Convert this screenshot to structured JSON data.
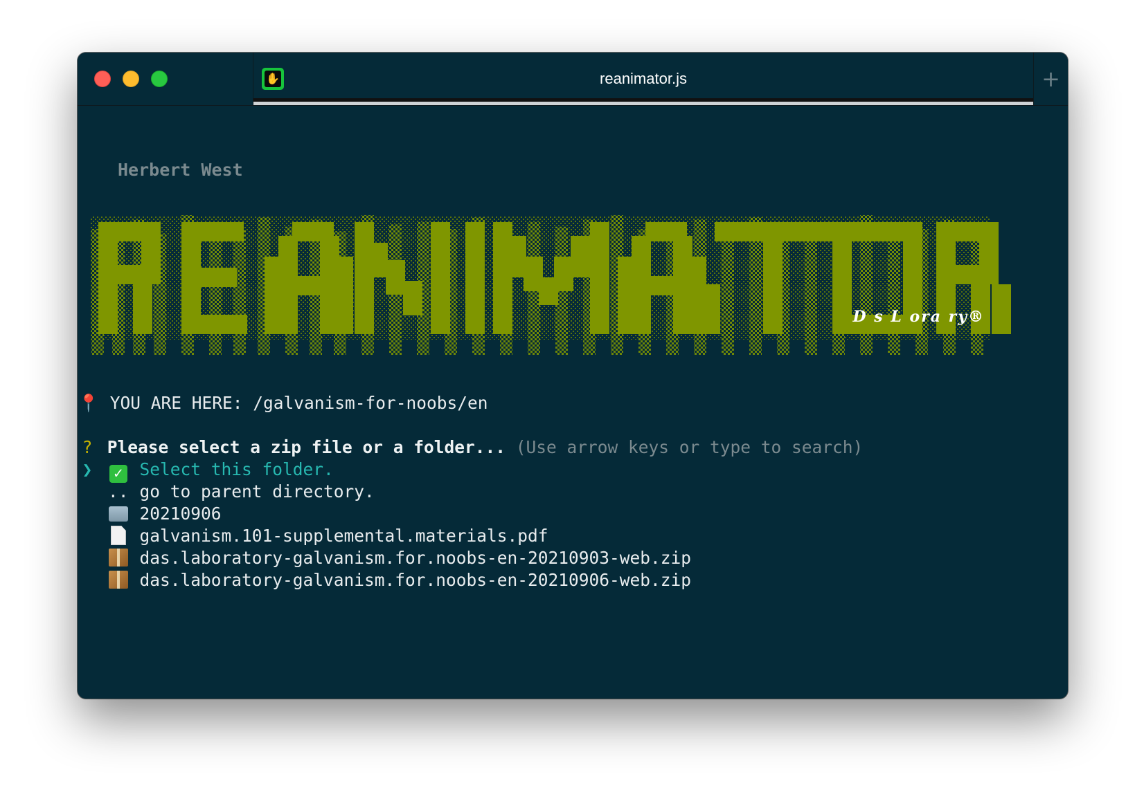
{
  "window": {
    "tab_title": "reanimator.js",
    "new_tab_label": "+",
    "tab_icon": "hand-icon"
  },
  "banner": {
    "subtitle": "Herbert West",
    "logo_text": "REANIMATOR",
    "lab_label": "D s L ora ry®",
    "logo_color": "#7f9600"
  },
  "location": {
    "icon": "pushpin-icon",
    "text": "YOU ARE HERE: /galvanism-for-noobs/en"
  },
  "prompt": {
    "marker": "?",
    "question": "Please select a zip file or a folder...",
    "hint": "(Use arrow keys or type to search)",
    "cursor": "❯"
  },
  "choices": [
    {
      "icon": "checkmark-icon",
      "label": "Select this folder.",
      "selected": true
    },
    {
      "icon": "parent-dots",
      "label": "go to parent directory.",
      "prefix": "..",
      "selected": false
    },
    {
      "icon": "folder-icon",
      "label": "20210906",
      "selected": false
    },
    {
      "icon": "document-icon",
      "label": "galvanism.101-supplemental.materials.pdf",
      "selected": false
    },
    {
      "icon": "package-icon",
      "label": "das.laboratory-galvanism.for.noobs-en-20210903-web.zip",
      "selected": false
    },
    {
      "icon": "package-icon",
      "label": "das.laboratory-galvanism.for.noobs-en-20210906-web.zip",
      "selected": false
    }
  ]
}
